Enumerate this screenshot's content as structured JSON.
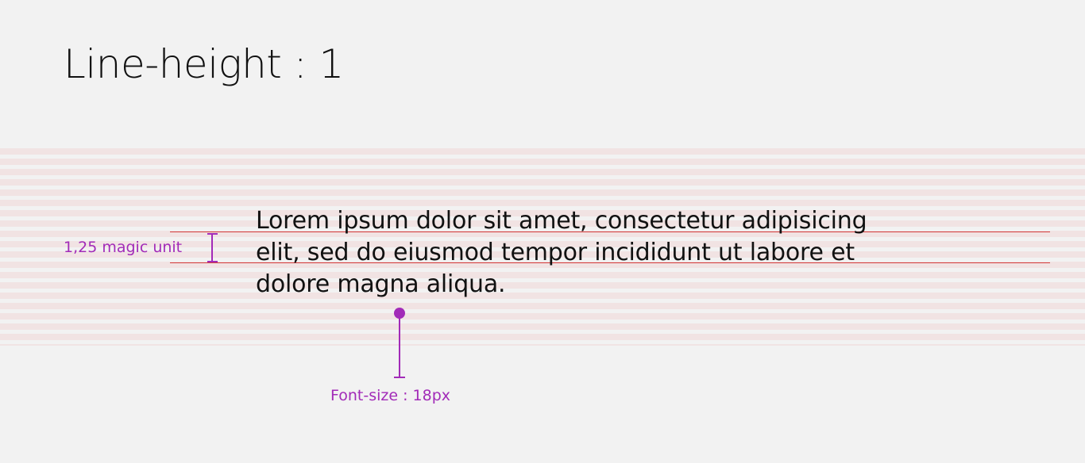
{
  "title": "Line-height : 1",
  "sample_text": "Lorem ipsum dolor sit amet, consectetur adipisicing\nelit, sed do eiusmod tempor incididunt ut labore et\ndolore magna aliqua.",
  "annotations": {
    "line_height_label": "1,25 magic unit",
    "font_size_label": "Font-size : 18px"
  },
  "colors": {
    "background": "#f2f2f2",
    "grid_stripe": "#f1e3e3",
    "guide_line": "#d23b3b",
    "annotation": "#a22bb8",
    "text": "#111111"
  }
}
